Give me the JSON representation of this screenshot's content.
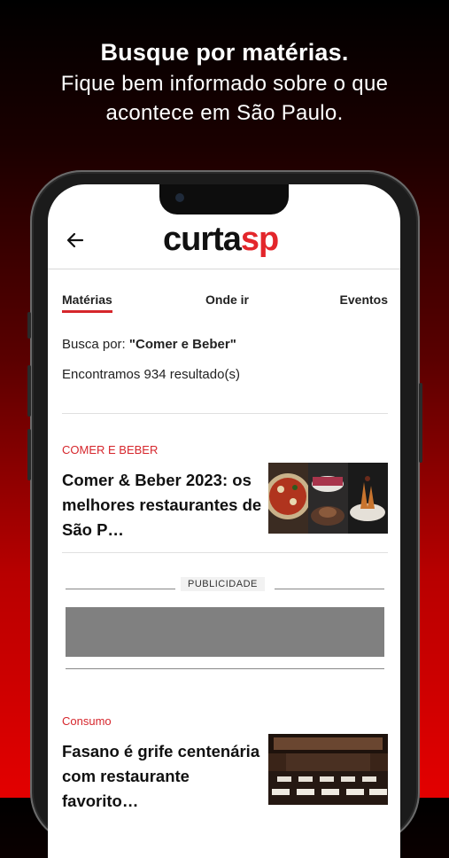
{
  "promo": {
    "headline": "Busque por matérias.",
    "subline_1": "Fique bem informado sobre o que",
    "subline_2": "acontece em São Paulo."
  },
  "appbar": {
    "logo_part1": "curta",
    "logo_part2": "sp",
    "back_icon": "arrow-left-icon"
  },
  "tabs": [
    {
      "label": "Matérias",
      "active": true
    },
    {
      "label": "Onde ir",
      "active": false
    },
    {
      "label": "Eventos",
      "active": false
    }
  ],
  "search": {
    "prefix": "Busca por: ",
    "query": "\"Comer e Beber\"",
    "results_text": "Encontramos 934 resultado(s)"
  },
  "articles": [
    {
      "category": "COMER E BEBER",
      "title": "Comer & Beber 2023: os melhores restaurantes de São P…"
    },
    {
      "category": "Consumo",
      "title": "Fasano é grife centenária com restaurante favorito…"
    }
  ],
  "ad": {
    "label": "PUBLICIDADE"
  },
  "colors": {
    "accent": "#d6262c",
    "logo_red": "#e3262b",
    "background_top": "#000000",
    "background_bottom": "#e30000"
  }
}
